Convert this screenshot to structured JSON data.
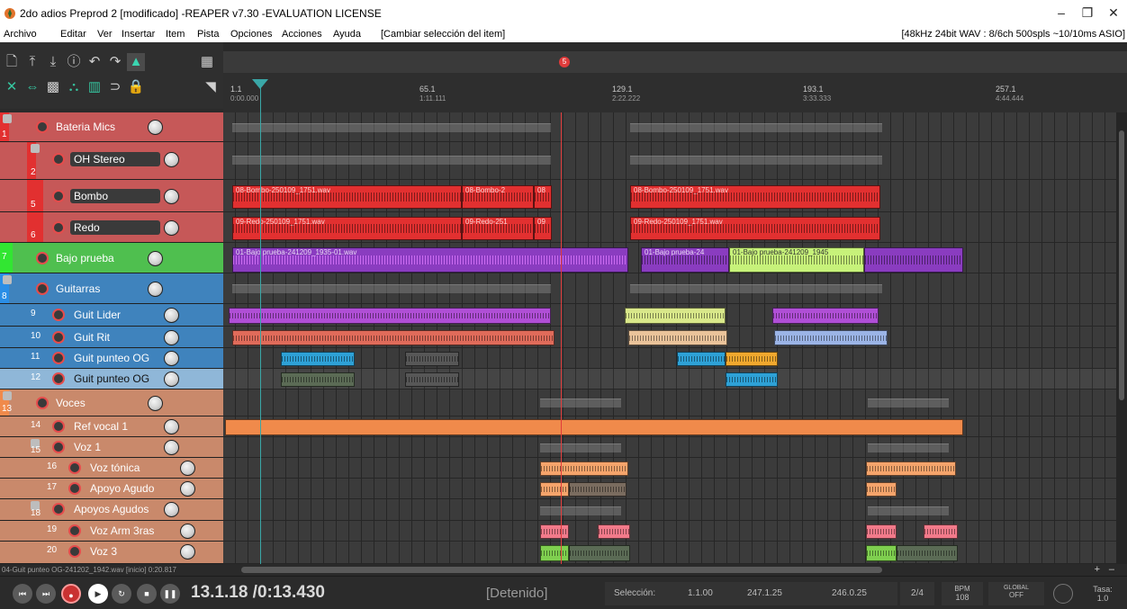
{
  "window": {
    "title": "2do adios Preprod 2 [modificado] -REAPER v7.30 -EVALUATION LICENSE",
    "min": "–",
    "max": "❐",
    "close": "✕"
  },
  "menu": {
    "items": [
      "Archivo",
      "Editar",
      "Ver",
      "Insertar",
      "Item",
      "Pista",
      "Opciones",
      "Acciones",
      "Ayuda",
      "[Cambiar selección del item]"
    ],
    "audio_status": "[48kHz 24bit WAV : 8/6ch 500spls ~10/10ms ASIO]"
  },
  "ruler": {
    "marks": [
      {
        "bar": "1.1",
        "time": "0:00.000"
      },
      {
        "bar": "65.1",
        "time": "1:11.111"
      },
      {
        "bar": "129.1",
        "time": "2:22.222"
      },
      {
        "bar": "193.1",
        "time": "3:33.333"
      },
      {
        "bar": "257.1",
        "time": "4:44.444"
      }
    ],
    "marker_label": "5"
  },
  "tracks": [
    {
      "num": "1",
      "name": "Bateria Mics",
      "color": "#c65858",
      "folder": true
    },
    {
      "num": "2",
      "name": "OH Stereo",
      "color": "#c65858",
      "folder": true
    },
    {
      "num": "5",
      "name": "Bombo",
      "color": "#c65858",
      "folder": false
    },
    {
      "num": "6",
      "name": "Redo",
      "color": "#c65858",
      "folder": false
    },
    {
      "num": "7",
      "name": "Bajo prueba",
      "color": "#4fbf4f",
      "folder": false
    },
    {
      "num": "8",
      "name": "Guitarras",
      "color": "#3f83bd",
      "folder": true
    },
    {
      "num": "9",
      "name": "Guit Lider",
      "color": "#3f83bd",
      "folder": false
    },
    {
      "num": "10",
      "name": "Guit Rit",
      "color": "#3f83bd",
      "folder": false
    },
    {
      "num": "11",
      "name": "Guit punteo OG",
      "color": "#3f83bd",
      "folder": false
    },
    {
      "num": "12",
      "name": "Guit punteo OG",
      "color": "#8fb7d8",
      "folder": false
    },
    {
      "num": "13",
      "name": "Voces",
      "color": "#c9896b",
      "folder": true
    },
    {
      "num": "14",
      "name": "Ref vocal 1",
      "color": "#c9896b",
      "folder": false
    },
    {
      "num": "15",
      "name": "Voz 1",
      "color": "#c9896b",
      "folder": true
    },
    {
      "num": "16",
      "name": "Voz tónica",
      "color": "#c9896b",
      "folder": false
    },
    {
      "num": "17",
      "name": "Apoyo Agudo",
      "color": "#c9896b",
      "folder": false
    },
    {
      "num": "18",
      "name": "Apoyos Agudos",
      "color": "#c9896b",
      "folder": true
    },
    {
      "num": "19",
      "name": "Voz Arm 3ras",
      "color": "#c9896b",
      "folder": false
    },
    {
      "num": "20",
      "name": "Voz 3",
      "color": "#c9896b",
      "folder": false
    }
  ],
  "items": {
    "bombo_1": "08-Bombo-250109_1751.wav",
    "bombo_2": "08-Bombo-2",
    "bombo_3": "08",
    "bombo_4": "08-Bombo-250109_1751.wav",
    "redo_1": "09-Redo-250109_1751.wav",
    "redo_2": "09-Redo-251",
    "redo_3": "09",
    "redo_4": "09-Redo-250109_1751.wav",
    "bajo_1": "01-Bajo prueba-241209_1935-01.wav",
    "bajo_2": "01-Bajo prueba-24",
    "bajo_3": "01-Bajo prueba-241209_1945"
  },
  "bottom_left_status": "04-Guit punteo OG-241202_1942.wav [inicio] 0:20.817",
  "transport": {
    "position": "13.1.18 /0:13.430",
    "state": "[Detenido]",
    "selection_label": "Selección:",
    "sel_start": "1.1.00",
    "sel_end": "247.1.25",
    "sel_length": "246.0.25",
    "time_signature": "2/4",
    "bpm_label": "BPM",
    "bpm_value": "108",
    "global_label": "GLOBAL",
    "global_value": "OFF",
    "rate_label": "Tasa:",
    "rate_value": "1.0"
  },
  "colors": {
    "drums": "#e23030",
    "bass": "#a64fd6",
    "guitar": "#c26bd6",
    "vocals": "#f08a4b",
    "background": "#3b3b3b"
  }
}
